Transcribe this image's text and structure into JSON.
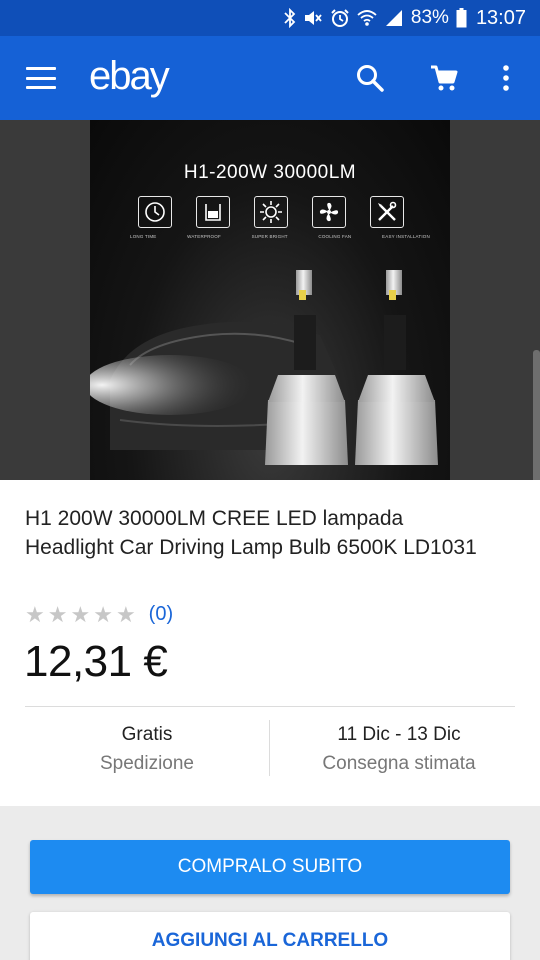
{
  "status_bar": {
    "battery": "83%",
    "time": "13:07",
    "icons": [
      "bluetooth-icon",
      "mute-icon",
      "alarm-icon",
      "wifi-icon",
      "signal-icon",
      "battery-icon"
    ]
  },
  "app_bar": {
    "logo": "ebay",
    "icons": [
      "menu-icon",
      "search-icon",
      "cart-icon",
      "more-vert-icon"
    ],
    "color": "#1561d6"
  },
  "product_image": {
    "headline": "H1-200W 30000LM",
    "features": [
      "LONG TIME",
      "WATERPROOF",
      "SUPER BRIGHT",
      "COOLING FAN",
      "EASY INSTALLATION"
    ]
  },
  "product": {
    "title": "H1 200W 30000LM CREE LED lampada Headlight Car Driving Lamp Bulb 6500K LD1031",
    "rating_stars": 0,
    "review_count": "(0)",
    "price": "12,31 €"
  },
  "shipping": {
    "cost": "Gratis",
    "cost_label": "Spedizione",
    "delivery": "11 Dic - 13 Dic",
    "delivery_label": "Consegna stimata"
  },
  "actions": {
    "buy_now": "COMPRALO SUBITO",
    "add_to_cart": "AGGIUNGI AL CARRELLO",
    "accent": "#1d8bf1"
  }
}
